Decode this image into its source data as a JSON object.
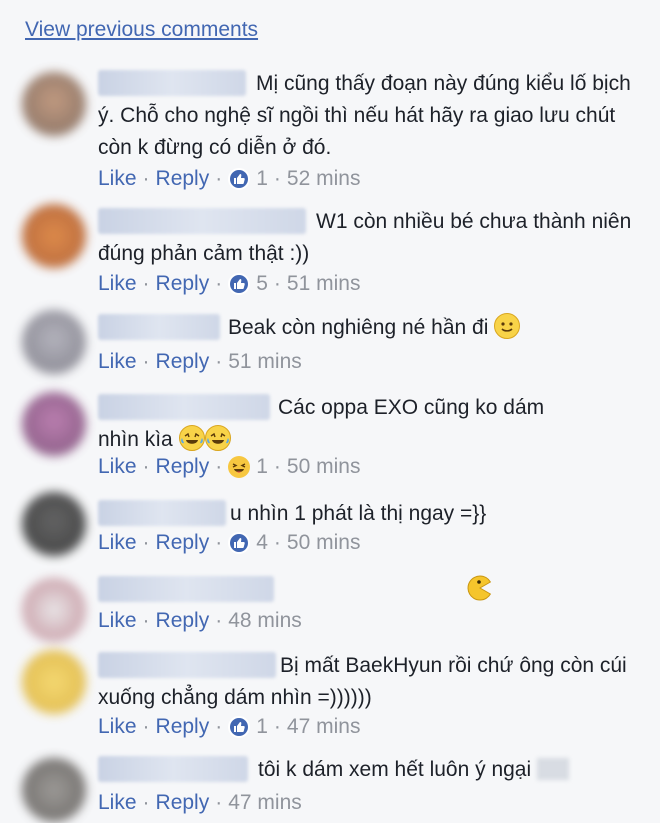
{
  "header": {
    "view_previous": "View previous comments"
  },
  "actions": {
    "like": "Like",
    "reply": "Reply",
    "sep": "·"
  },
  "comments": [
    {
      "text": "Mị cũng thấy đoạn này đúng kiểu lố bịch ý. Chỗ cho nghệ sĩ ngồi thì nếu hát hãy ra giao lưu chút còn k đừng có diễn ở đó.",
      "reaction": "like",
      "count": "1",
      "time": "52 mins"
    },
    {
      "text": "W1 còn nhiều bé chưa thành niên đúng phản cảm thật :))",
      "reaction": "like",
      "count": "5",
      "time": "51 mins"
    },
    {
      "text": "Beak còn nghiêng né hần đi",
      "emoji": "slight-smile-icon",
      "reaction": "",
      "count": "",
      "time": "51 mins"
    },
    {
      "text": "Các oppa EXO cũng ko dám nhìn kìa",
      "emoji": "joy-tears-icon",
      "reaction": "haha",
      "count": "1",
      "time": "50 mins"
    },
    {
      "text": "u nhìn 1 phát là thị ngay =}}",
      "reaction": "like",
      "count": "4",
      "time": "50 mins"
    },
    {
      "text": "",
      "emoji": "pacman-icon",
      "reaction": "",
      "count": "",
      "time": "48 mins"
    },
    {
      "text": "Bị mất BaekHyun rồi chứ ông còn cúi xuống chẳng dám nhìn =))))))",
      "reaction": "like",
      "count": "1",
      "time": "47 mins"
    },
    {
      "text": "tôi k dám xem hết luôn ý ngại",
      "reaction": "",
      "count": "",
      "time": "47 mins"
    }
  ],
  "colors": {
    "link": "#4267b2",
    "meta": "#90949c",
    "text": "#1d2129",
    "bg": "#f6f7f9"
  }
}
